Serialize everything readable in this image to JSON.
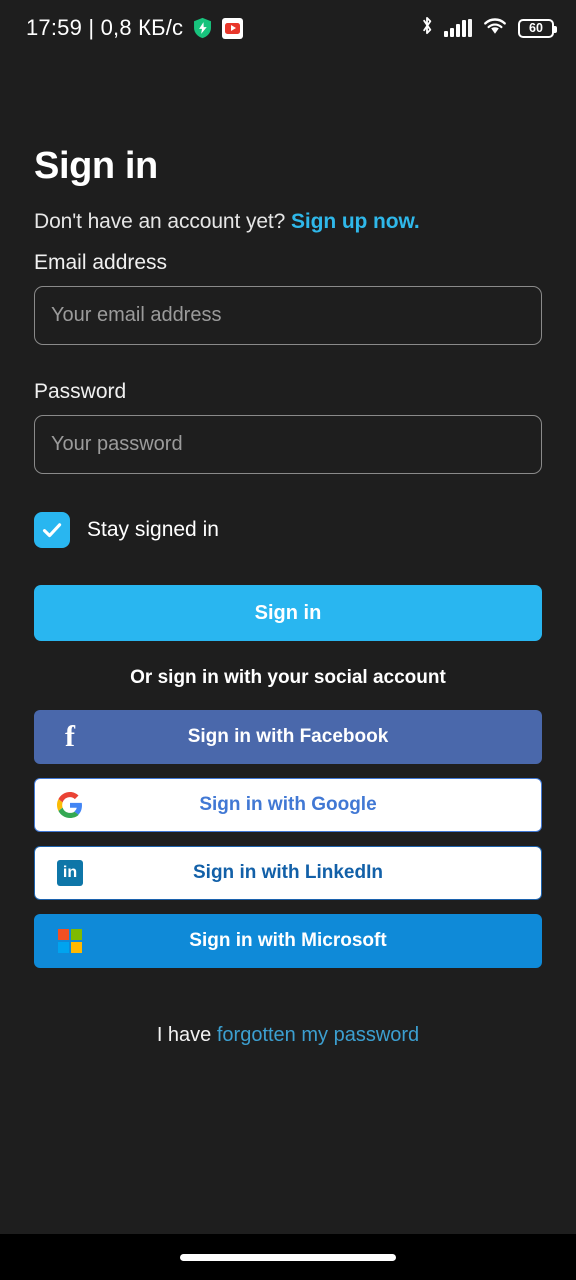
{
  "status_bar": {
    "clock": "17:59 | 0,8 КБ/с",
    "icons": [
      "shield-bolt-icon",
      "youtube-icon",
      "bluetooth-icon",
      "cellular-signal-icon",
      "wifi-icon"
    ],
    "battery_percent": "60"
  },
  "page": {
    "title": "Sign in",
    "signup_prompt": "Don't have an account yet?",
    "signup_link": "Sign up now."
  },
  "form": {
    "email_label": "Email address",
    "email_placeholder": "Your email address",
    "email_value": "",
    "password_label": "Password",
    "password_placeholder": "Your password",
    "password_value": "",
    "stay_signed_in_label": "Stay signed in",
    "stay_signed_in_checked": true,
    "submit_label": "Sign in"
  },
  "social": {
    "divider_text": "Or sign in with your social account",
    "buttons": [
      {
        "label": "Sign in with Facebook",
        "icon": "facebook-icon",
        "bg": "#4a68ab",
        "text_color": "#ffffff"
      },
      {
        "label": "Sign in with Google",
        "icon": "google-icon",
        "bg": "#ffffff",
        "text_color": "#4178d4"
      },
      {
        "label": "Sign in with LinkedIn",
        "icon": "linkedin-icon",
        "bg": "#ffffff",
        "text_color": "#1260a8"
      },
      {
        "label": "Sign in with Microsoft",
        "icon": "microsoft-icon",
        "bg": "#0f8ad8",
        "text_color": "#ffffff"
      }
    ]
  },
  "footer": {
    "forgot_prefix": "I have ",
    "forgot_link": "forgotten my password"
  },
  "colors": {
    "background": "#1e1e1e",
    "accent": "#29b6f0",
    "link": "#2fb8ea",
    "input_border": "#8a8a8a",
    "forgot_link": "#3c9fd0"
  }
}
